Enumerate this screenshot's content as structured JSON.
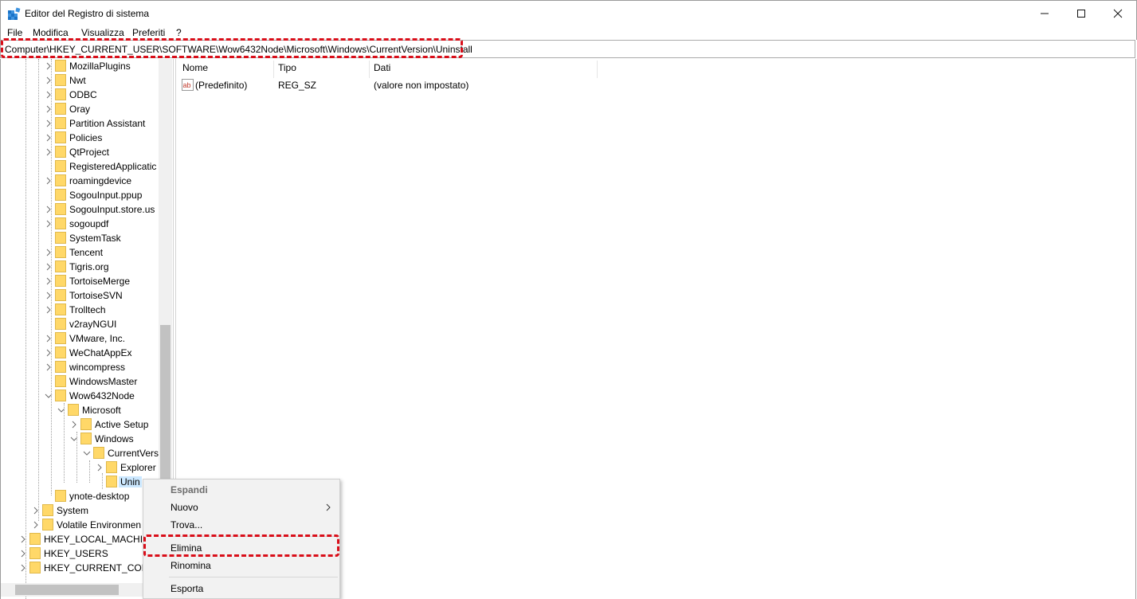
{
  "window": {
    "title": "Editor del Registro di sistema"
  },
  "menu": [
    "File",
    "Modifica",
    "Visualizza",
    "Preferiti",
    "?"
  ],
  "address": "Computer\\HKEY_CURRENT_USER\\SOFTWARE\\Wow6432Node\\Microsoft\\Windows\\CurrentVersion\\Uninstall",
  "tree": [
    {
      "label": "MozillaPlugins",
      "chevron": "right"
    },
    {
      "label": "Nwt",
      "chevron": "right"
    },
    {
      "label": "ODBC",
      "chevron": "right"
    },
    {
      "label": "Oray",
      "chevron": "right"
    },
    {
      "label": "Partition Assistant",
      "chevron": "right"
    },
    {
      "label": "Policies",
      "chevron": "right"
    },
    {
      "label": "QtProject",
      "chevron": "right"
    },
    {
      "label": "RegisteredApplicatic",
      "chevron": "none"
    },
    {
      "label": "roamingdevice",
      "chevron": "right"
    },
    {
      "label": "SogouInput.ppup",
      "chevron": "none"
    },
    {
      "label": "SogouInput.store.us",
      "chevron": "right"
    },
    {
      "label": "sogoupdf",
      "chevron": "right"
    },
    {
      "label": "SystemTask",
      "chevron": "none"
    },
    {
      "label": "Tencent",
      "chevron": "right"
    },
    {
      "label": "Tigris.org",
      "chevron": "right"
    },
    {
      "label": "TortoiseMerge",
      "chevron": "right"
    },
    {
      "label": "TortoiseSVN",
      "chevron": "right"
    },
    {
      "label": "Trolltech",
      "chevron": "right"
    },
    {
      "label": "v2rayNGUI",
      "chevron": "none"
    },
    {
      "label": "VMware, Inc.",
      "chevron": "right"
    },
    {
      "label": "WeChatAppEx",
      "chevron": "right"
    },
    {
      "label": "wincompress",
      "chevron": "right"
    },
    {
      "label": "WindowsMaster",
      "chevron": "none"
    },
    {
      "label": "Wow6432Node",
      "chevron": "down"
    },
    {
      "label": "Microsoft",
      "chevron": "down"
    },
    {
      "label": "Active Setup",
      "chevron": "right"
    },
    {
      "label": "Windows",
      "chevron": "down"
    },
    {
      "label": "CurrentVers",
      "chevron": "down"
    },
    {
      "label": "Explorer",
      "chevron": "right"
    },
    {
      "label": "Unin",
      "chevron": "none",
      "selected": true
    },
    {
      "label": "ynote-desktop",
      "chevron": "none"
    },
    {
      "label": "System",
      "chevron": "right"
    },
    {
      "label": "Volatile Environmen",
      "chevron": "right"
    },
    {
      "label": "HKEY_LOCAL_MACHIN",
      "chevron": "right"
    },
    {
      "label": "HKEY_USERS",
      "chevron": "right"
    },
    {
      "label": "HKEY_CURRENT_CONF",
      "chevron": "right"
    }
  ],
  "list": {
    "columns": [
      "Nome",
      "Tipo",
      "Dati"
    ],
    "rows": [
      {
        "name": "(Predefinito)",
        "type": "REG_SZ",
        "data": "(valore non impostato)"
      }
    ]
  },
  "context_menu": {
    "items": [
      {
        "label": "Espandi",
        "disabled": true
      },
      {
        "label": "Nuovo",
        "submenu": true
      },
      {
        "label": "Trova..."
      },
      {
        "separator": true
      },
      {
        "label": "Elimina",
        "highlighted": true
      },
      {
        "label": "Rinomina"
      },
      {
        "separator": true
      },
      {
        "label": "Esporta"
      }
    ]
  },
  "colors": {
    "highlight_dashed": "#d90e19",
    "folder": "#ffd868",
    "selection": "#cce8ff"
  }
}
